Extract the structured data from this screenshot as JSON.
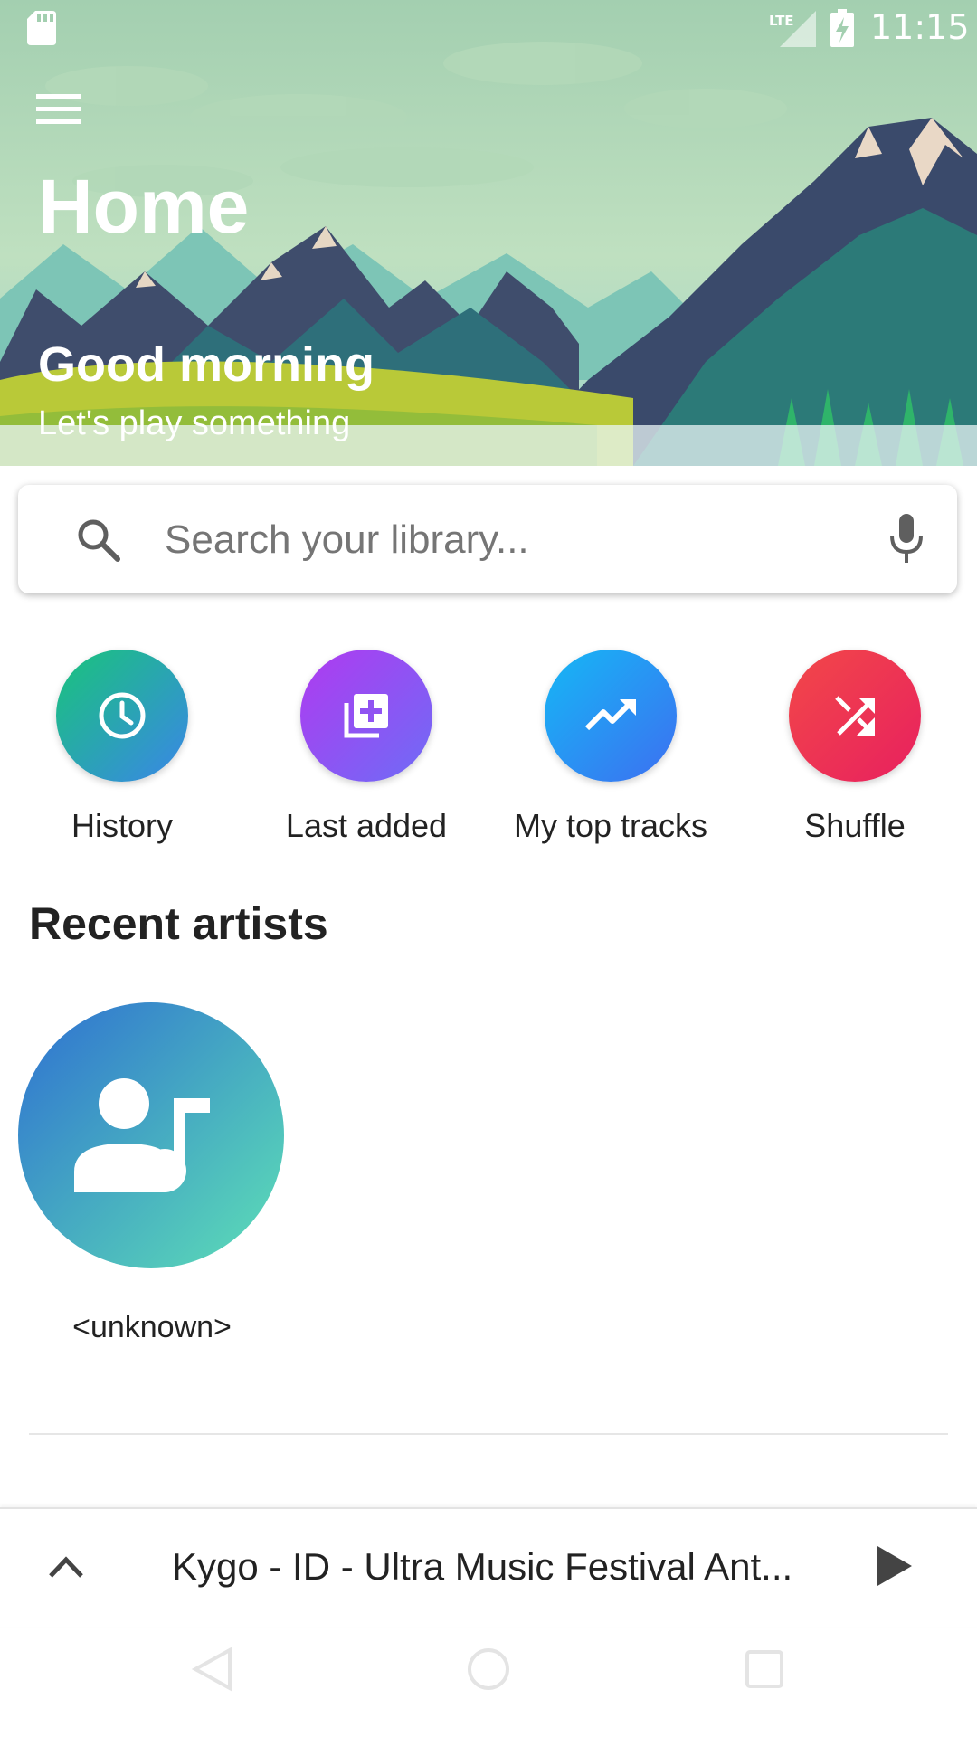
{
  "status_bar": {
    "time": "11:15",
    "network_label": "LTE",
    "icons": [
      "sd-card-icon",
      "lte-signal-icon",
      "battery-charging-icon"
    ]
  },
  "header": {
    "title": "Home",
    "greeting": "Good morning",
    "subtitle": "Let's play something",
    "menu_icon": "hamburger-menu-icon"
  },
  "search": {
    "placeholder": "Search your library...",
    "value": "",
    "icon": "search-icon",
    "mic_icon": "microphone-icon"
  },
  "quick_actions": [
    {
      "label": "History",
      "icon": "clock-icon",
      "colors": [
        "#19c47a",
        "#3a86e8"
      ]
    },
    {
      "label": "Last added",
      "icon": "library-add-icon",
      "colors": [
        "#b03af0",
        "#6e6cf6"
      ]
    },
    {
      "label": "My top tracks",
      "icon": "trending-up-icon",
      "colors": [
        "#15b8f5",
        "#3d6ff1"
      ]
    },
    {
      "label": "Shuffle",
      "icon": "shuffle-icon",
      "colors": [
        "#f24848",
        "#e8205f"
      ]
    }
  ],
  "recent_artists": {
    "title": "Recent artists",
    "items": [
      {
        "name": "<unknown>",
        "icon": "artist-music-icon"
      }
    ]
  },
  "mini_player": {
    "track": "Kygo - ID - Ultra Music Festival Ant...",
    "expand_icon": "chevron-up-icon",
    "play_icon": "play-icon"
  },
  "nav_bar": {
    "icons": [
      "back-icon",
      "home-icon",
      "recents-icon"
    ]
  }
}
